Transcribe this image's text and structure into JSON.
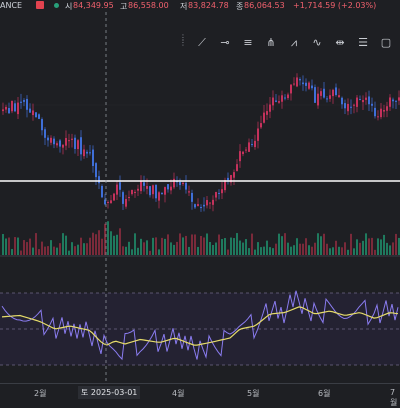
{
  "header": {
    "exchange": "ANCE",
    "open_label": "시",
    "open_value": "84,349.95",
    "high_label": "고",
    "high_value": "86,558.00",
    "low_label": "저",
    "low_value": "83,824.78",
    "close_label": "종",
    "close_value": "86,064.53",
    "change": "+1,714.59 (+2.03%)"
  },
  "toolbar": {
    "tools": [
      "trend-line-icon",
      "horizontal-ray-icon",
      "parallel-channel-icon",
      "pitchfork-icon",
      "xabcd-pattern-icon",
      "elliott-wave-icon",
      "date-range-icon",
      "price-range-icon",
      "rectangle-icon"
    ]
  },
  "xaxis": {
    "labels": [
      "2월",
      "4월",
      "5월",
      "6월",
      "7월"
    ],
    "crosshair_date": "토  2025-03-01"
  },
  "colors": {
    "background": "#1e1f23",
    "up": "#c5325c",
    "down": "#3f6fd8",
    "volume_up": "#1f7a5e",
    "volume_down": "#7a2a3a",
    "rsi_line": "#8a7cf0",
    "rsi_ma": "#e6dc6a",
    "horizontal_line": "#ffffff"
  }
}
